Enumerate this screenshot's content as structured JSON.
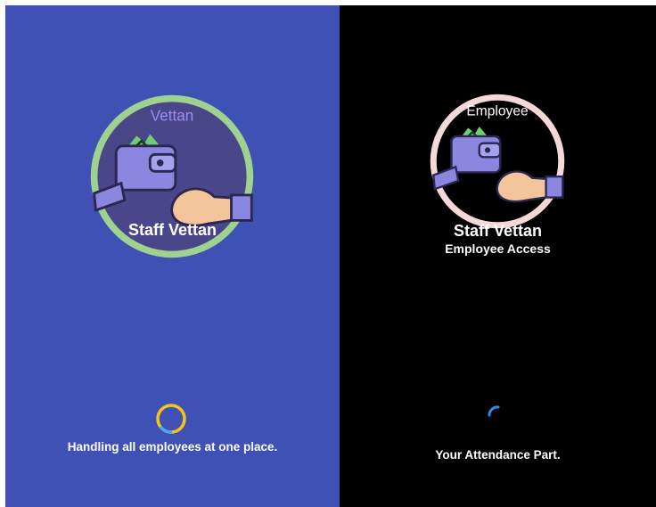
{
  "admin_splash": {
    "logo_label": "Vettan",
    "app_name": "Staff Vettan",
    "tagline": "Handling all employees at one place.",
    "background_color": "#3f51b5",
    "ring_color": "#9ed28e",
    "spinner_color": "#f5c518",
    "icon": "wallet-hand-icon"
  },
  "employee_splash": {
    "logo_label": "Employee",
    "app_name": "Staff Vettan",
    "subtitle": "Employee Access",
    "tagline": "Your Attendance Part.",
    "background_color": "#000000",
    "ring_color": "#f6d8d8",
    "spinner_color": "#2f8ce8",
    "icon": "wallet-hand-icon"
  }
}
